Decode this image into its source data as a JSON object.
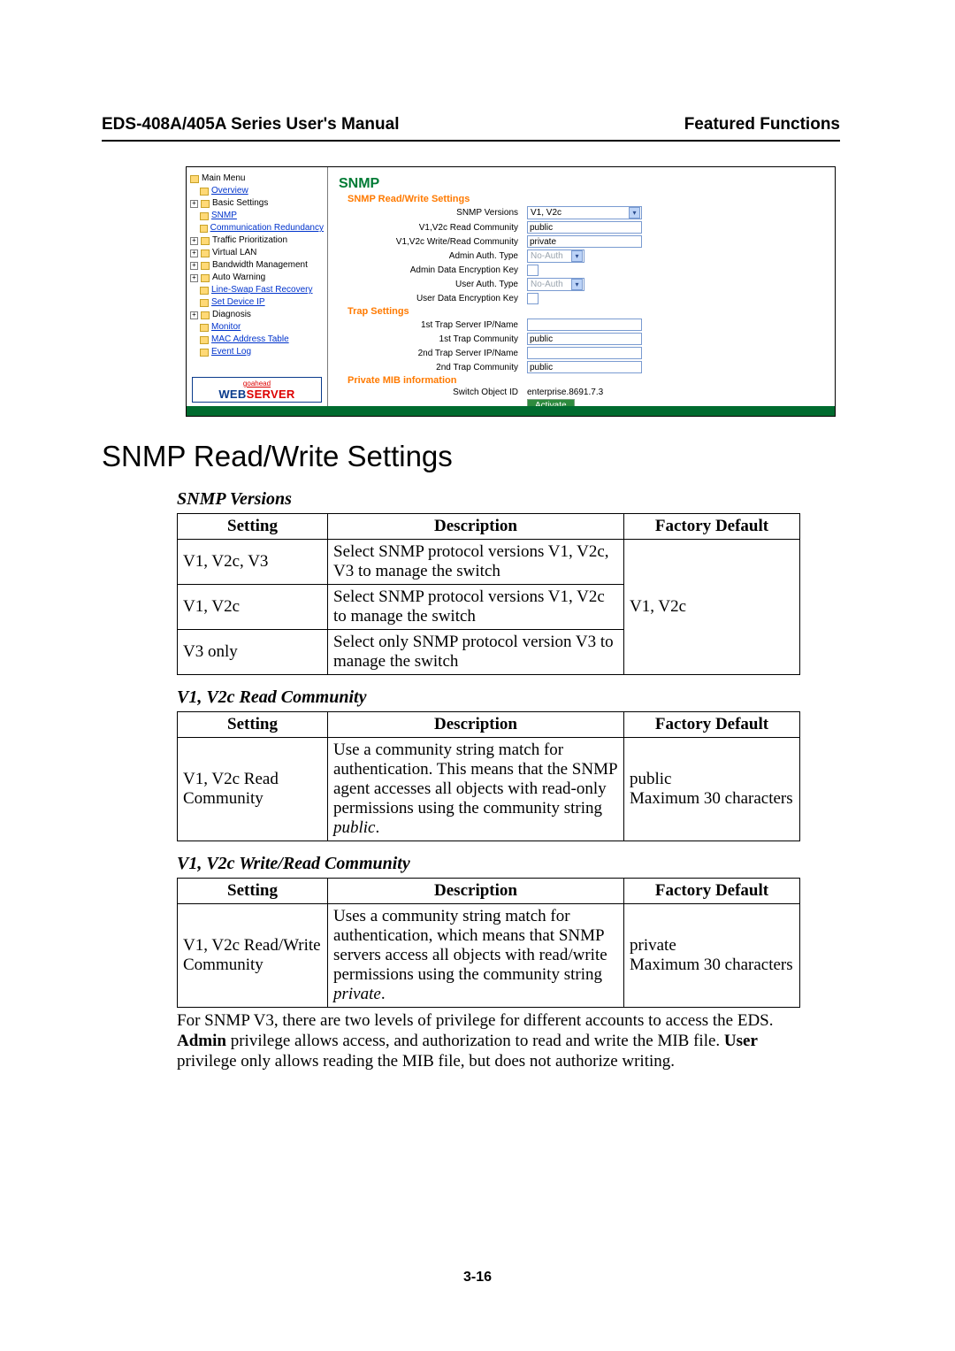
{
  "header": {
    "left": "EDS-408A/405A Series User's Manual",
    "right": "Featured Functions"
  },
  "screenshot": {
    "snmp_title": "SNMP",
    "sections": {
      "rw": "SNMP Read/Write Settings",
      "trap": "Trap Settings",
      "mib": "Private MIB information"
    },
    "labels": {
      "versions": "SNMP Versions",
      "read_comm": "V1,V2c Read Community",
      "write_comm": "V1,V2c Write/Read Community",
      "admin_auth": "Admin Auth. Type",
      "admin_key": "Admin Data Encryption Key",
      "user_auth": "User Auth. Type",
      "user_key": "User Data Encryption Key",
      "trap1_ip": "1st Trap Server IP/Name",
      "trap1_comm": "1st Trap Community",
      "trap2_ip": "2nd Trap Server IP/Name",
      "trap2_comm": "2nd Trap Community",
      "switch_oid": "Switch Object ID"
    },
    "values": {
      "versions": "V1, V2c",
      "read_comm": "public",
      "write_comm": "private",
      "admin_auth": "No-Auth",
      "user_auth": "No-Auth",
      "trap1_ip": "",
      "trap1_comm": "public",
      "trap2_ip": "",
      "trap2_comm": "public",
      "switch_oid": "enterprise.8691.7.3",
      "activate": "Activate"
    },
    "tree": {
      "main": "Main Menu",
      "overview": "Overview",
      "basic": "Basic Settings",
      "snmp": "SNMP",
      "comm_red": "Communication Redundancy",
      "traffic": "Traffic Prioritization",
      "vlan": "Virtual LAN",
      "bw": "Bandwidth Management",
      "autowarn": "Auto Warning",
      "lineswap": "Line-Swap Fast Recovery",
      "setip": "Set Device IP",
      "diag": "Diagnosis",
      "monitor": "Monitor",
      "mac": "MAC Address Table",
      "event": "Event Log"
    },
    "webserver": {
      "goa": "goahead",
      "brand": "WEB",
      "srv": "SERVER"
    }
  },
  "h2": "SNMP Read/Write Settings",
  "tables": {
    "versions": {
      "title": "SNMP Versions",
      "head": {
        "setting": "Setting",
        "desc": "Description",
        "def": "Factory Default"
      },
      "rows": [
        {
          "setting": "V1, V2c, V3",
          "desc": "Select SNMP protocol versions V1, V2c, V3 to manage the switch"
        },
        {
          "setting": "V1, V2c",
          "desc": "Select SNMP protocol versions V1, V2c to manage the switch",
          "def": "V1, V2c"
        },
        {
          "setting": "V3 only",
          "desc": "Select only SNMP protocol version V3 to manage the switch"
        }
      ]
    },
    "readcomm": {
      "title": "V1, V2c Read Community",
      "head": {
        "setting": "Setting",
        "desc": "Description",
        "def": "Factory Default"
      },
      "rows": [
        {
          "setting": "V1, V2c Read Community",
          "desc_pre": "Use a community string match for authentication. This means that the SNMP agent accesses all objects with read-only permissions using the community string ",
          "desc_em": "public",
          "desc_post": ".",
          "def": "public\nMaximum 30 characters"
        }
      ]
    },
    "writecomm": {
      "title": "V1, V2c Write/Read Community",
      "head": {
        "setting": "Setting",
        "desc": "Description",
        "def": "Factory Default"
      },
      "rows": [
        {
          "setting": "V1, V2c Read/Write Community",
          "desc_pre": "Uses a community string match for authentication, which means that SNMP servers access all objects with read/write permissions using the community string ",
          "desc_em": "private",
          "desc_post": ".",
          "def": "private\nMaximum 30 characters"
        }
      ]
    }
  },
  "para": {
    "pre": "For SNMP V3, there are two levels of privilege for different accounts to access the EDS. ",
    "b1": "Admin",
    "mid": " privilege allows access, and authorization to read and write the MIB file. ",
    "b2": "User",
    "post": " privilege only allows reading the MIB file, but does not authorize writing."
  },
  "page_no": "3-16"
}
